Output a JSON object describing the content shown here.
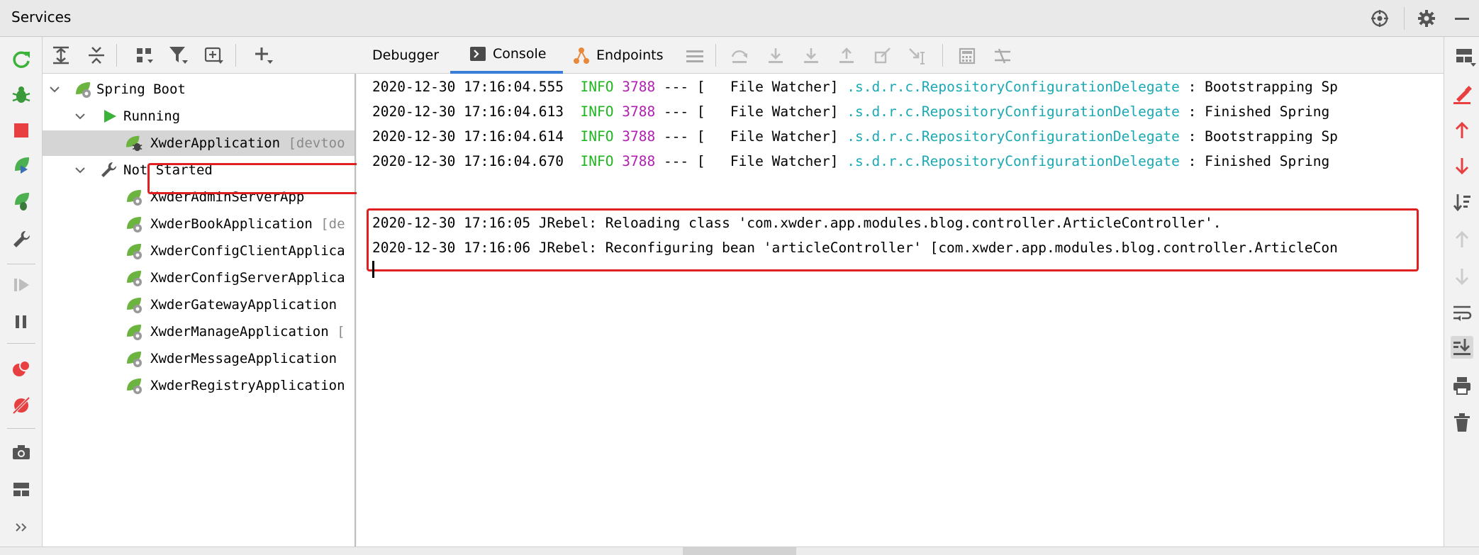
{
  "window": {
    "title": "Services"
  },
  "tree": {
    "items": [
      {
        "label": "Spring Boot",
        "suffix": ""
      },
      {
        "label": "Running",
        "suffix": ""
      },
      {
        "label": "XwderApplication",
        "suffix": " [devtoo"
      },
      {
        "label": "Not Started",
        "suffix": ""
      },
      {
        "label": "XwderAdminServerApp",
        "suffix": ""
      },
      {
        "label": "XwderBookApplication",
        "suffix": " [de"
      },
      {
        "label": "XwderConfigClientApplica",
        "suffix": ""
      },
      {
        "label": "XwderConfigServerApplica",
        "suffix": ""
      },
      {
        "label": "XwderGatewayApplication",
        "suffix": ""
      },
      {
        "label": "XwderManageApplication",
        "suffix": " ["
      },
      {
        "label": "XwderMessageApplication",
        "suffix": ""
      },
      {
        "label": "XwderRegistryApplication",
        "suffix": ""
      }
    ]
  },
  "tabs": [
    {
      "label": "Debugger"
    },
    {
      "label": "Console"
    },
    {
      "label": "Endpoints"
    }
  ],
  "console": {
    "info_lines": [
      {
        "ts": "2020-12-30 17:16:04.555",
        "level": "INFO",
        "pid": "3788",
        "sep": " --- [",
        "thread": "   File Watcher]",
        "cls": ".s.d.r.c.RepositoryConfigurationDelegate",
        "msg": " : Bootstrapping Sp"
      },
      {
        "ts": "2020-12-30 17:16:04.613",
        "level": "INFO",
        "pid": "3788",
        "sep": " --- [",
        "thread": "   File Watcher]",
        "cls": ".s.d.r.c.RepositoryConfigurationDelegate",
        "msg": " : Finished Spring"
      },
      {
        "ts": "2020-12-30 17:16:04.614",
        "level": "INFO",
        "pid": "3788",
        "sep": " --- [",
        "thread": "   File Watcher]",
        "cls": ".s.d.r.c.RepositoryConfigurationDelegate",
        "msg": " : Bootstrapping Sp"
      },
      {
        "ts": "2020-12-30 17:16:04.670",
        "level": "INFO",
        "pid": "3788",
        "sep": " --- [",
        "thread": "   File Watcher]",
        "cls": ".s.d.r.c.RepositoryConfigurationDelegate",
        "msg": " : Finished Spring"
      }
    ],
    "jrebel_lines": [
      "2020-12-30 17:16:05 JRebel: Reloading class 'com.xwder.app.modules.blog.controller.ArticleController'.",
      "2020-12-30 17:16:06 JRebel: Reconfiguring bean 'articleController' [com.xwder.app.modules.blog.controller.ArticleCon"
    ]
  },
  "colors": {
    "info": "#1fb51f",
    "pid": "#b21fb2",
    "logger": "#1aa9b3",
    "highlight": "#e02020",
    "tab_active": "#3b7ed8"
  },
  "icons": {
    "title": [
      "crosshair-icon",
      "gear-icon",
      "minimize-icon"
    ],
    "left_strip": [
      "refresh-icon",
      "debug-bug-icon",
      "stop-icon",
      "run-icon",
      "debug-run-icon",
      "wrench-icon",
      "resume-icon",
      "pause-icon",
      "breakpoints-icon",
      "mute-breakpoints-icon",
      "camera-icon",
      "layout-icon",
      "more-icon"
    ],
    "tree_toolbar": [
      "expand-all-icon",
      "collapse-all-icon",
      "group-icon",
      "filter-icon",
      "new-group-icon",
      "add-icon"
    ],
    "right_strip": [
      "clear-icon",
      "up-arrow-red-icon",
      "down-arrow-red-icon",
      "sort-down-icon",
      "up-arrow-gray-icon",
      "down-arrow-gray-icon",
      "soft-wrap-icon",
      "scroll-to-end-icon",
      "print-icon",
      "trash-icon"
    ]
  }
}
